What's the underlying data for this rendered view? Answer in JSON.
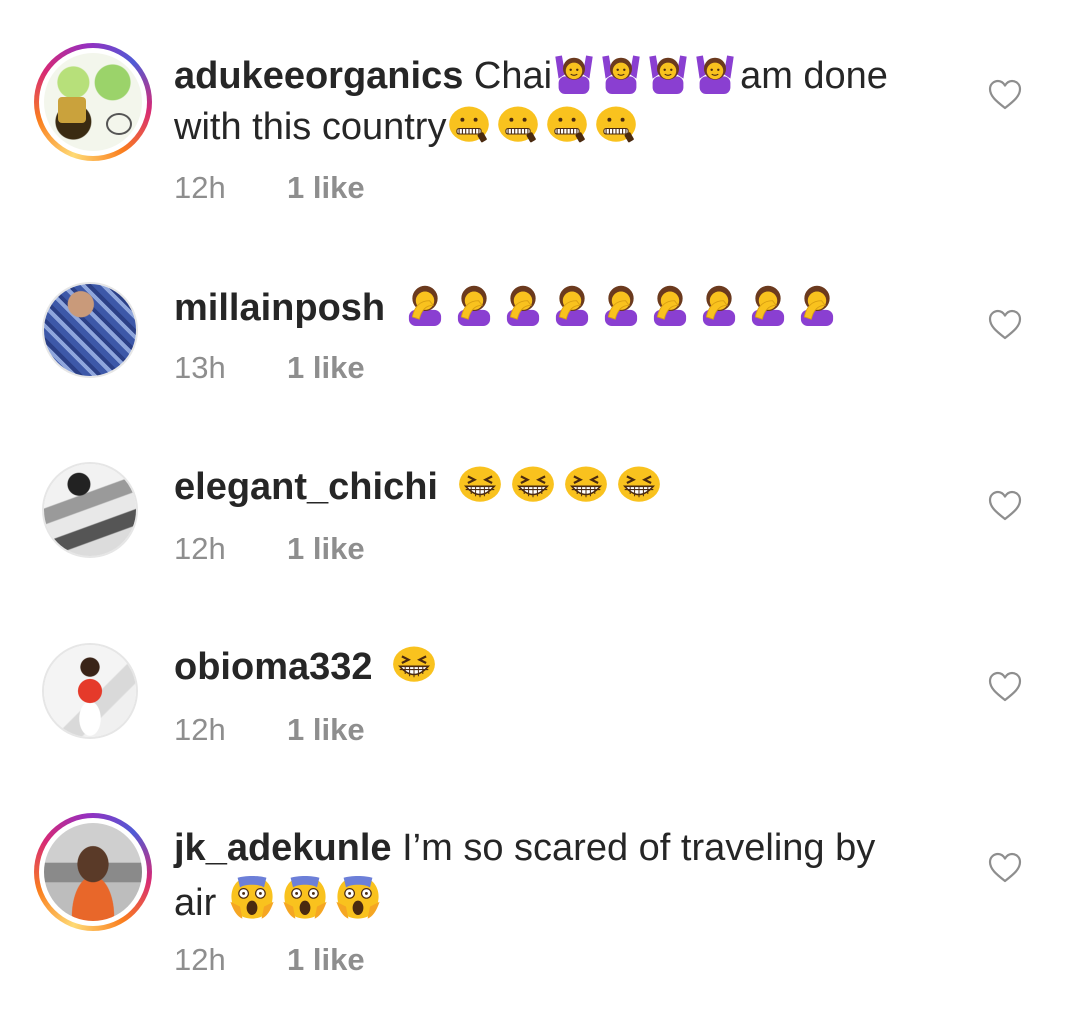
{
  "comments": [
    {
      "username": "adukeeorganics",
      "text_a": "Chai",
      "text_b": "am done",
      "text_c": "with this country",
      "time": "12h",
      "likes": "1 like",
      "avatar_ring": true
    },
    {
      "username": "millainposh",
      "time": "13h",
      "likes": "1 like",
      "avatar_ring": false
    },
    {
      "username": "elegant_chichi",
      "time": "12h",
      "likes": "1 like",
      "avatar_ring": false
    },
    {
      "username": "obioma332",
      "time": "12h",
      "likes": "1 like",
      "avatar_ring": false
    },
    {
      "username": "jk_adekunle",
      "text_a": "I’m so scared of traveling by",
      "text_b": "air",
      "time": "12h",
      "likes": "1 like",
      "avatar_ring": true
    }
  ],
  "icons": {
    "like": "heart-outline-icon",
    "emoji_1": "woman-gesturing-ok-emoji",
    "emoji_2": "zipper-mouth-face-emoji",
    "emoji_3": "woman-facepalming-emoji",
    "emoji_4": "grinning-squinting-face-emoji",
    "emoji_5": "face-screaming-in-fear-emoji"
  },
  "colors": {
    "text": "#262626",
    "meta": "#8e8e8e",
    "emoji_yellow": "#f9c21e",
    "emoji_purple": "#8a3fd1"
  }
}
